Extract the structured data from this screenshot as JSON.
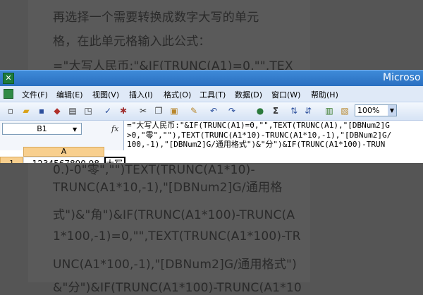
{
  "article": {
    "lines_top": [
      "再选择一个需要转换成数字大写的单元",
      "格，在此单元格输入此公式：",
      "=\"大写人民币:\"&IF(TRUNC(A1)=0,\"\",TEX"
    ],
    "lines_bottom": [
      "0.)-0\"零\",\"\")TEXT(TRUNC(A1*10)-",
      "TRUNC(A1*10,-1),\"[DBNum2]G/通用格",
      "式\")&\"角\")&IF(TRUNC(A1*100)-TRUNC(A",
      "1*100,-1)=0,\"\",TEXT(TRUNC(A1*100)-TR",
      "UNC(A1*100,-1),\"[DBNum2]G/通用格式\")",
      "&\"分\")&IF(TRUNC(A1*100)-TRUNC(A1*10"
    ]
  },
  "excel": {
    "app_title": "Microso",
    "menu": [
      "文件(F)",
      "编辑(E)",
      "视图(V)",
      "插入(I)",
      "格式(O)",
      "工具(T)",
      "数据(D)",
      "窗口(W)",
      "帮助(H)"
    ],
    "zoom": "100%",
    "name_box": "B1",
    "fx": "fx",
    "formula_lines": [
      "=\"大写人民币:\"&IF(TRUNC(A1)=0,\"\",TEXT(TRUNC(A1),\"[DBNum2]G",
      ">0,\"零\",\"\"),TEXT(TRUNC(A1*10)-TRUNC(A1*10,-1),\"[DBNum2]G/",
      "100,-1),\"[DBNum2]G/通用格式\")&\"分\")&IF(TRUNC(A1*100)-TRUN"
    ],
    "column_a": "A",
    "row_1": "1",
    "cell_a1": "1234567890.98",
    "cell_b1": "大写"
  },
  "icons": {
    "app": "excel-icon",
    "toolbar": [
      "new-icon",
      "open-icon",
      "save-icon",
      "permission-icon",
      "print-icon",
      "print-preview-icon",
      "spelling-icon",
      "research-icon",
      "cut-icon",
      "copy-icon",
      "paste-icon",
      "format-painter-icon",
      "undo-icon",
      "redo-icon",
      "hyperlink-icon",
      "autosum-icon",
      "sort-ascending-icon",
      "sort-descending-icon",
      "chart-wizard-icon",
      "drawing-icon"
    ]
  }
}
